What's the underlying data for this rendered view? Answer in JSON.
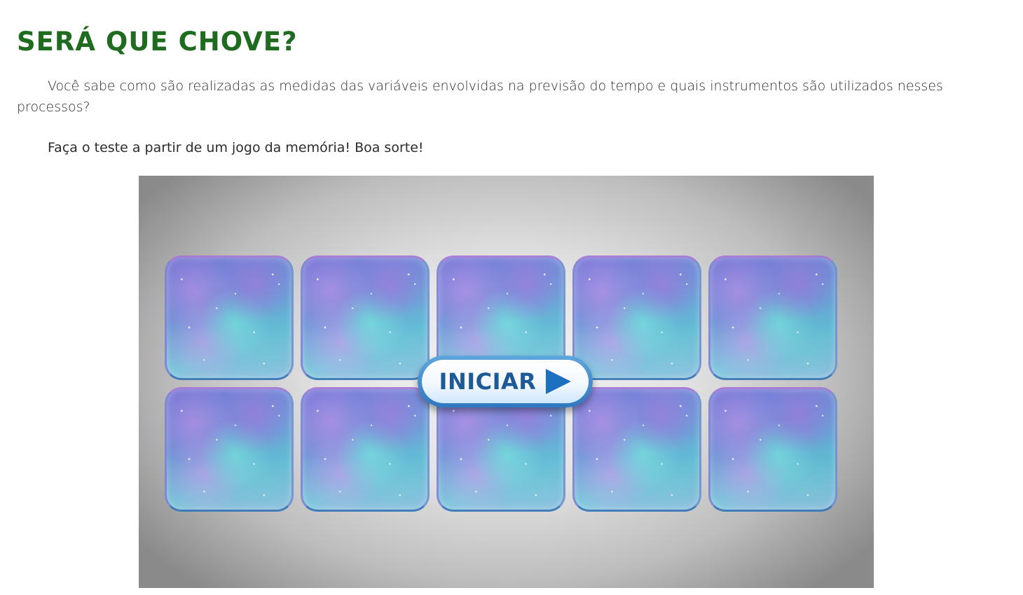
{
  "page": {
    "title": "SERÁ QUE CHOVE?",
    "intro": "Você sabe como são realizadas as medidas das variáveis envolvidas na previsão do tempo e quais instrumentos são utilizados nesses processos?",
    "prompt": "Faça o teste a partir de um jogo da memória! Boa sorte!"
  },
  "game": {
    "start_label": "INICIAR",
    "play_icon": "play-triangle-icon",
    "card_count": 10,
    "colors": {
      "title": "#1f6b1f",
      "button_text": "#1d5a97",
      "card_border": "#3a78b8"
    }
  }
}
